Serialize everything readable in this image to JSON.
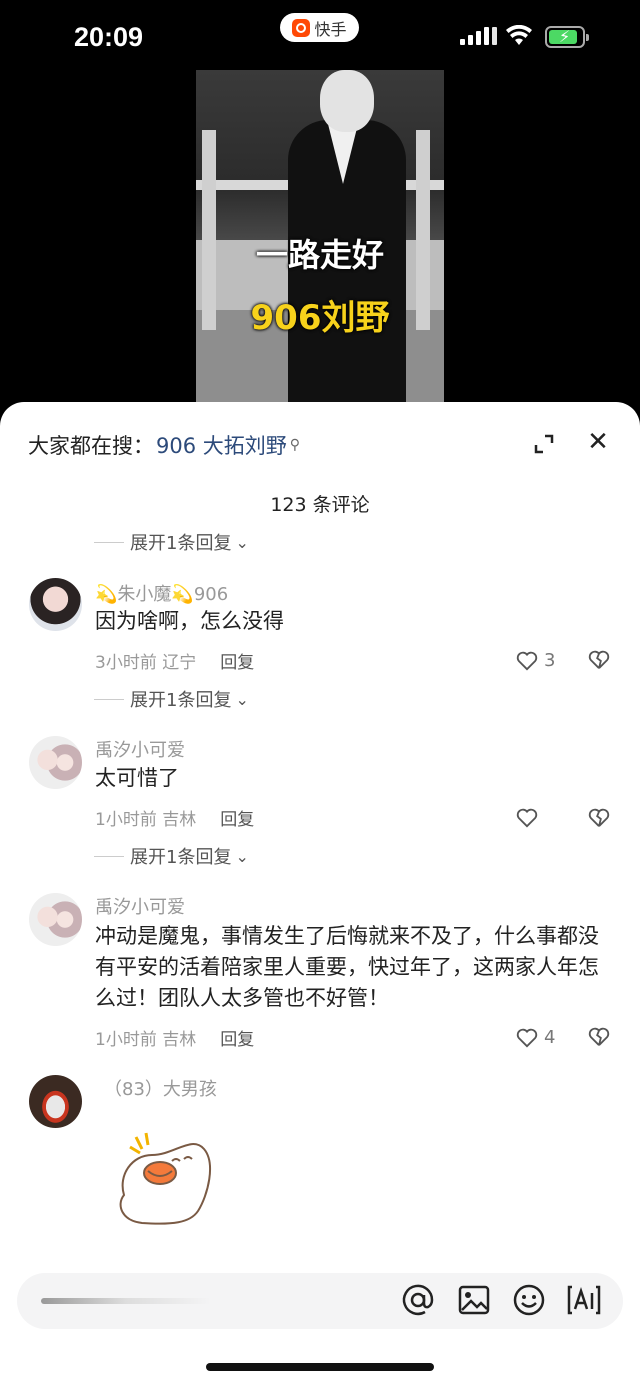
{
  "status_bar": {
    "time": "20:09",
    "app_pill_label": "快手"
  },
  "video": {
    "caption_line1": "一路走好",
    "caption_line2": "906刘野"
  },
  "search": {
    "prefix": "大家都在搜：",
    "term": "906 大拓刘野"
  },
  "comments_count": "123 条评论",
  "expand_replies_label": "展开1条回复",
  "comments": [
    {
      "user": "💫朱小魔💫906",
      "text": "因为啥啊，怎么没得",
      "time": "3小时前",
      "location": "辽宁",
      "reply": "回复",
      "likes": "3"
    },
    {
      "user": "禹汐小可爱",
      "text": "太可惜了",
      "time": "1小时前",
      "location": "吉林",
      "reply": "回复",
      "likes": ""
    },
    {
      "user": "禹汐小可爱",
      "text": "冲动是魔鬼，事情发生了后悔就来不及了，什么事都没有平安的活着陪家里人重要，快过年了，这两家人年怎么过！团队人太多管也不好管！",
      "time": "1小时前",
      "location": "吉林",
      "reply": "回复",
      "likes": "4"
    },
    {
      "user": "（83）大男孩",
      "text": "",
      "time": "",
      "location": "",
      "reply": "",
      "likes": ""
    }
  ],
  "icons": {
    "at": "at-icon",
    "image": "image-icon",
    "emoji": "emoji-icon",
    "ai": "ai-text-icon",
    "like": "heart-icon",
    "dislike": "broken-heart-icon",
    "close": "close-icon",
    "expand": "expand-icon"
  },
  "colors": {
    "search_term": "#2c4a7a",
    "caption_highlight": "#f7d21b",
    "app_brand": "#ff4906"
  }
}
